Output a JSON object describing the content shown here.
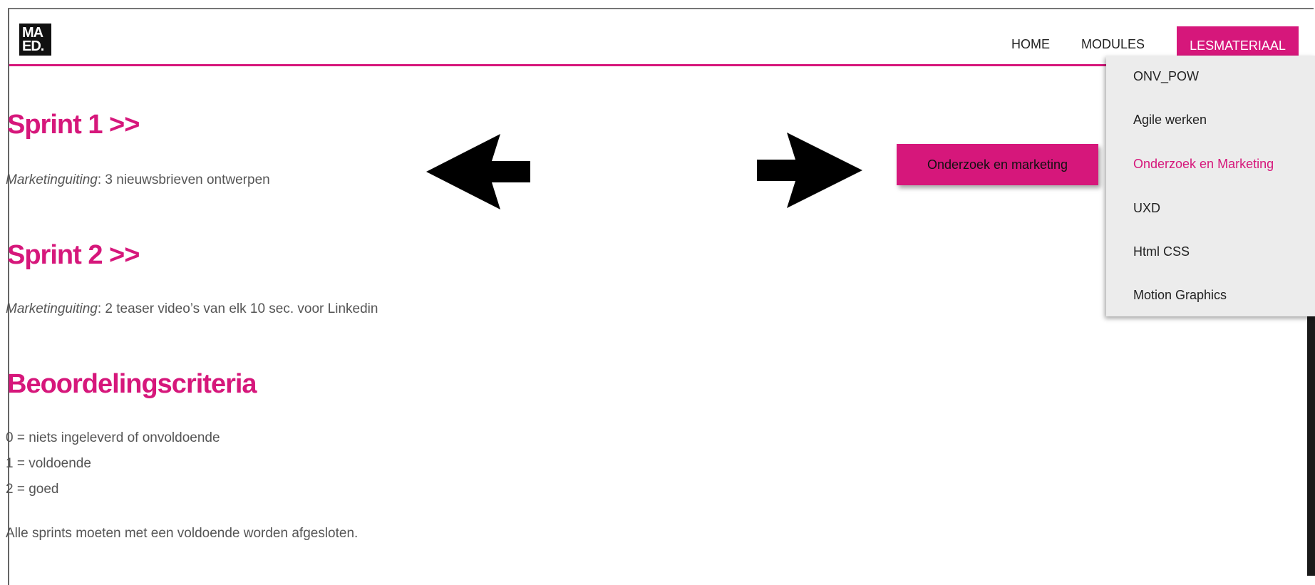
{
  "logo": {
    "line1": "MA",
    "line2": "ED."
  },
  "nav": {
    "home": "HOME",
    "modules": "MODULES",
    "lesmateriaal": "LESMATERIAAL"
  },
  "dropdown": {
    "items": [
      {
        "label": "ONV_POW"
      },
      {
        "label": "Agile werken"
      },
      {
        "label": "Onderzoek en Marketing",
        "active": true
      },
      {
        "label": "UXD"
      },
      {
        "label": "Html CSS"
      },
      {
        "label": "Motion Graphics"
      }
    ]
  },
  "tooltip_button": "Onderzoek en marketing",
  "content": {
    "sprint1_title": "Sprint 1 >>",
    "sprint1_label": "Marketinguiting",
    "sprint1_text": ": 3 nieuwsbrieven ontwerpen",
    "sprint2_title": "Sprint 2 >>",
    "sprint2_label": "Marketinguiting",
    "sprint2_text": ": 2 teaser video’s van elk 10 sec. voor Linkedin",
    "criteria_title": "Beoordelingscriteria",
    "criteria": [
      "0 = niets ingeleverd of onvoldoende",
      "1 = voldoende",
      "2 = goed"
    ],
    "closing": "Alle sprints moeten met een voldoende worden afgesloten."
  },
  "colors": {
    "accent": "#d6177b",
    "dropdown_bg": "#ececec"
  },
  "icons": [
    "left-arrow-icon",
    "right-arrow-icon"
  ]
}
